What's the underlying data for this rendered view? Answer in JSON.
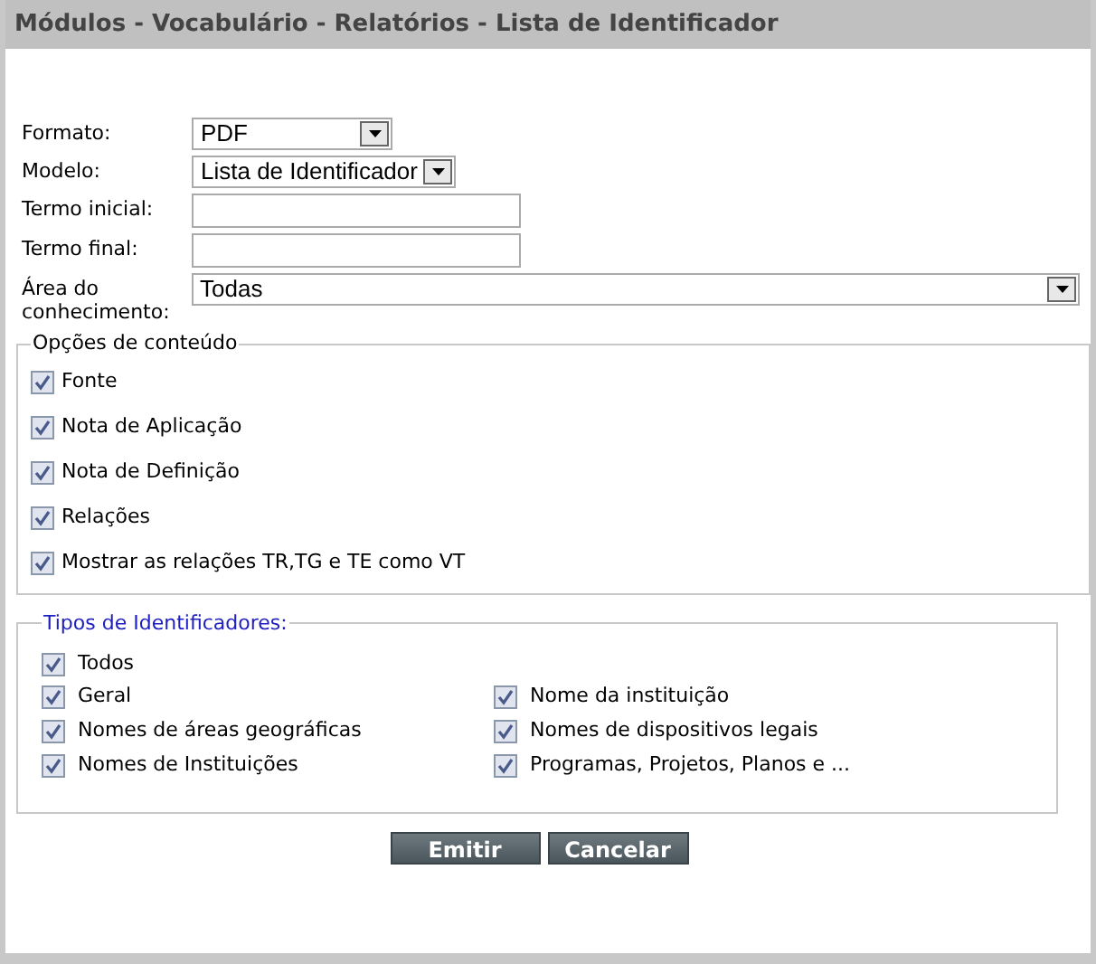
{
  "window": {
    "title": "Módulos - Vocabulário - Relatórios - Lista de Identificador"
  },
  "form": [
    {
      "kind": "select",
      "label": "Formato:",
      "value": "PDF"
    },
    {
      "kind": "select",
      "label": "Modelo:",
      "value": "Lista de Identificador"
    },
    {
      "kind": "text",
      "label": "Termo inicial:"
    },
    {
      "kind": "text",
      "label": "Termo final:"
    },
    {
      "kind": "select",
      "label": "Área do conhecimento:",
      "value": "Todas"
    }
  ],
  "content_options": {
    "legend": "Opções de conteúdo",
    "items": [
      {
        "label": "Fonte",
        "checked": true
      },
      {
        "label": "Nota de Aplicação",
        "checked": true
      },
      {
        "label": "Nota de Definição",
        "checked": true
      },
      {
        "label": "Relações",
        "checked": true
      },
      {
        "label": "Mostrar as relações TR,TG e TE como VT",
        "checked": true
      }
    ]
  },
  "identifier_types": {
    "legend": "Tipos de Identificadores:",
    "all": {
      "label": "Todos",
      "checked": true
    },
    "items": [
      {
        "label": "Geral",
        "checked": true
      },
      {
        "label": "Nome da instituição",
        "checked": true
      },
      {
        "label": "Nomes de áreas geográficas",
        "checked": true
      },
      {
        "label": "Nomes de dispositivos legais",
        "checked": true
      },
      {
        "label": "Nomes de Instituições",
        "checked": true
      },
      {
        "label": "Programas, Projetos, Planos e ...",
        "checked": true
      }
    ]
  },
  "buttons": [
    "Emitir",
    "Cancelar"
  ]
}
